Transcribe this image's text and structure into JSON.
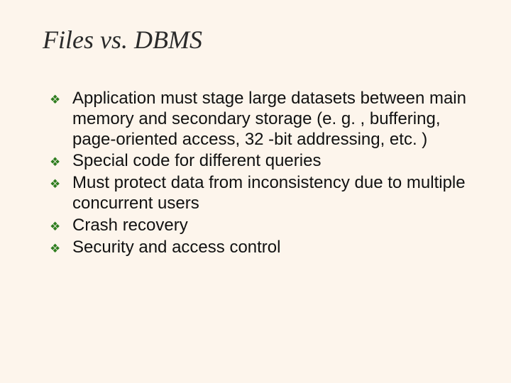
{
  "title": "Files vs. DBMS",
  "bullet_glyph": "❖",
  "bullets": [
    "Application must stage large datasets between main memory and secondary storage (e. g. , buffering, page-oriented access, 32 -bit addressing, etc. )",
    "Special code for different queries",
    "Must protect data from inconsistency due to multiple concurrent users",
    "Crash recovery",
    "Security and access control"
  ]
}
